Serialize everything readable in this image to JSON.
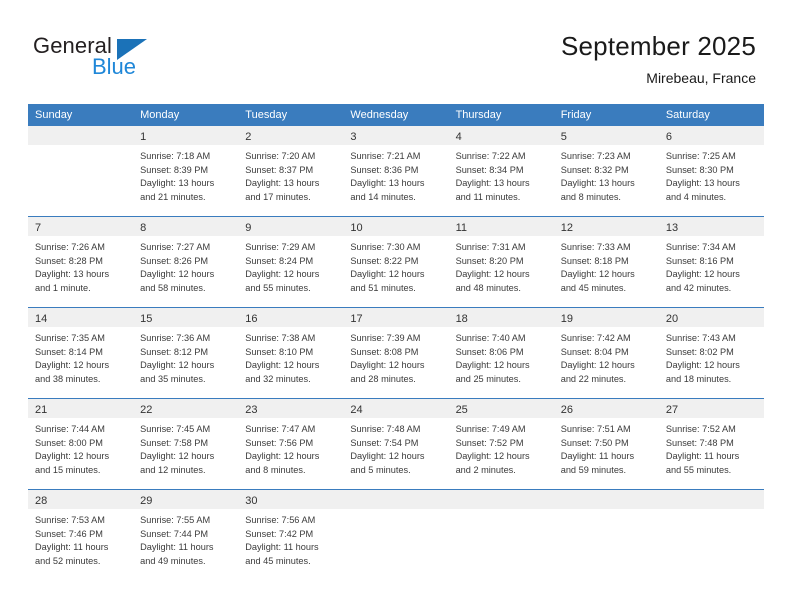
{
  "brand": {
    "name_primary": "General",
    "name_secondary": "Blue",
    "logo_icon": "triangle-logo-icon"
  },
  "header": {
    "title": "September 2025",
    "subtitle": "Mirebeau, France"
  },
  "colors": {
    "header_blue": "#3a7cbe",
    "brand_blue": "#1f87d8",
    "logo_blue": "#1b72b8",
    "daynum_band": "#f0f0f0",
    "text": "#3b3b3b"
  },
  "weekdays": [
    "Sunday",
    "Monday",
    "Tuesday",
    "Wednesday",
    "Thursday",
    "Friday",
    "Saturday"
  ],
  "weeks": [
    [
      {
        "day": "",
        "sunrise": "",
        "sunset": "",
        "daylight_line1": "",
        "daylight_line2": ""
      },
      {
        "day": "1",
        "sunrise": "Sunrise: 7:18 AM",
        "sunset": "Sunset: 8:39 PM",
        "daylight_line1": "Daylight: 13 hours",
        "daylight_line2": "and 21 minutes."
      },
      {
        "day": "2",
        "sunrise": "Sunrise: 7:20 AM",
        "sunset": "Sunset: 8:37 PM",
        "daylight_line1": "Daylight: 13 hours",
        "daylight_line2": "and 17 minutes."
      },
      {
        "day": "3",
        "sunrise": "Sunrise: 7:21 AM",
        "sunset": "Sunset: 8:36 PM",
        "daylight_line1": "Daylight: 13 hours",
        "daylight_line2": "and 14 minutes."
      },
      {
        "day": "4",
        "sunrise": "Sunrise: 7:22 AM",
        "sunset": "Sunset: 8:34 PM",
        "daylight_line1": "Daylight: 13 hours",
        "daylight_line2": "and 11 minutes."
      },
      {
        "day": "5",
        "sunrise": "Sunrise: 7:23 AM",
        "sunset": "Sunset: 8:32 PM",
        "daylight_line1": "Daylight: 13 hours",
        "daylight_line2": "and 8 minutes."
      },
      {
        "day": "6",
        "sunrise": "Sunrise: 7:25 AM",
        "sunset": "Sunset: 8:30 PM",
        "daylight_line1": "Daylight: 13 hours",
        "daylight_line2": "and 4 minutes."
      }
    ],
    [
      {
        "day": "7",
        "sunrise": "Sunrise: 7:26 AM",
        "sunset": "Sunset: 8:28 PM",
        "daylight_line1": "Daylight: 13 hours",
        "daylight_line2": "and 1 minute."
      },
      {
        "day": "8",
        "sunrise": "Sunrise: 7:27 AM",
        "sunset": "Sunset: 8:26 PM",
        "daylight_line1": "Daylight: 12 hours",
        "daylight_line2": "and 58 minutes."
      },
      {
        "day": "9",
        "sunrise": "Sunrise: 7:29 AM",
        "sunset": "Sunset: 8:24 PM",
        "daylight_line1": "Daylight: 12 hours",
        "daylight_line2": "and 55 minutes."
      },
      {
        "day": "10",
        "sunrise": "Sunrise: 7:30 AM",
        "sunset": "Sunset: 8:22 PM",
        "daylight_line1": "Daylight: 12 hours",
        "daylight_line2": "and 51 minutes."
      },
      {
        "day": "11",
        "sunrise": "Sunrise: 7:31 AM",
        "sunset": "Sunset: 8:20 PM",
        "daylight_line1": "Daylight: 12 hours",
        "daylight_line2": "and 48 minutes."
      },
      {
        "day": "12",
        "sunrise": "Sunrise: 7:33 AM",
        "sunset": "Sunset: 8:18 PM",
        "daylight_line1": "Daylight: 12 hours",
        "daylight_line2": "and 45 minutes."
      },
      {
        "day": "13",
        "sunrise": "Sunrise: 7:34 AM",
        "sunset": "Sunset: 8:16 PM",
        "daylight_line1": "Daylight: 12 hours",
        "daylight_line2": "and 42 minutes."
      }
    ],
    [
      {
        "day": "14",
        "sunrise": "Sunrise: 7:35 AM",
        "sunset": "Sunset: 8:14 PM",
        "daylight_line1": "Daylight: 12 hours",
        "daylight_line2": "and 38 minutes."
      },
      {
        "day": "15",
        "sunrise": "Sunrise: 7:36 AM",
        "sunset": "Sunset: 8:12 PM",
        "daylight_line1": "Daylight: 12 hours",
        "daylight_line2": "and 35 minutes."
      },
      {
        "day": "16",
        "sunrise": "Sunrise: 7:38 AM",
        "sunset": "Sunset: 8:10 PM",
        "daylight_line1": "Daylight: 12 hours",
        "daylight_line2": "and 32 minutes."
      },
      {
        "day": "17",
        "sunrise": "Sunrise: 7:39 AM",
        "sunset": "Sunset: 8:08 PM",
        "daylight_line1": "Daylight: 12 hours",
        "daylight_line2": "and 28 minutes."
      },
      {
        "day": "18",
        "sunrise": "Sunrise: 7:40 AM",
        "sunset": "Sunset: 8:06 PM",
        "daylight_line1": "Daylight: 12 hours",
        "daylight_line2": "and 25 minutes."
      },
      {
        "day": "19",
        "sunrise": "Sunrise: 7:42 AM",
        "sunset": "Sunset: 8:04 PM",
        "daylight_line1": "Daylight: 12 hours",
        "daylight_line2": "and 22 minutes."
      },
      {
        "day": "20",
        "sunrise": "Sunrise: 7:43 AM",
        "sunset": "Sunset: 8:02 PM",
        "daylight_line1": "Daylight: 12 hours",
        "daylight_line2": "and 18 minutes."
      }
    ],
    [
      {
        "day": "21",
        "sunrise": "Sunrise: 7:44 AM",
        "sunset": "Sunset: 8:00 PM",
        "daylight_line1": "Daylight: 12 hours",
        "daylight_line2": "and 15 minutes."
      },
      {
        "day": "22",
        "sunrise": "Sunrise: 7:45 AM",
        "sunset": "Sunset: 7:58 PM",
        "daylight_line1": "Daylight: 12 hours",
        "daylight_line2": "and 12 minutes."
      },
      {
        "day": "23",
        "sunrise": "Sunrise: 7:47 AM",
        "sunset": "Sunset: 7:56 PM",
        "daylight_line1": "Daylight: 12 hours",
        "daylight_line2": "and 8 minutes."
      },
      {
        "day": "24",
        "sunrise": "Sunrise: 7:48 AM",
        "sunset": "Sunset: 7:54 PM",
        "daylight_line1": "Daylight: 12 hours",
        "daylight_line2": "and 5 minutes."
      },
      {
        "day": "25",
        "sunrise": "Sunrise: 7:49 AM",
        "sunset": "Sunset: 7:52 PM",
        "daylight_line1": "Daylight: 12 hours",
        "daylight_line2": "and 2 minutes."
      },
      {
        "day": "26",
        "sunrise": "Sunrise: 7:51 AM",
        "sunset": "Sunset: 7:50 PM",
        "daylight_line1": "Daylight: 11 hours",
        "daylight_line2": "and 59 minutes."
      },
      {
        "day": "27",
        "sunrise": "Sunrise: 7:52 AM",
        "sunset": "Sunset: 7:48 PM",
        "daylight_line1": "Daylight: 11 hours",
        "daylight_line2": "and 55 minutes."
      }
    ],
    [
      {
        "day": "28",
        "sunrise": "Sunrise: 7:53 AM",
        "sunset": "Sunset: 7:46 PM",
        "daylight_line1": "Daylight: 11 hours",
        "daylight_line2": "and 52 minutes."
      },
      {
        "day": "29",
        "sunrise": "Sunrise: 7:55 AM",
        "sunset": "Sunset: 7:44 PM",
        "daylight_line1": "Daylight: 11 hours",
        "daylight_line2": "and 49 minutes."
      },
      {
        "day": "30",
        "sunrise": "Sunrise: 7:56 AM",
        "sunset": "Sunset: 7:42 PM",
        "daylight_line1": "Daylight: 11 hours",
        "daylight_line2": "and 45 minutes."
      },
      {
        "day": "",
        "sunrise": "",
        "sunset": "",
        "daylight_line1": "",
        "daylight_line2": ""
      },
      {
        "day": "",
        "sunrise": "",
        "sunset": "",
        "daylight_line1": "",
        "daylight_line2": ""
      },
      {
        "day": "",
        "sunrise": "",
        "sunset": "",
        "daylight_line1": "",
        "daylight_line2": ""
      },
      {
        "day": "",
        "sunrise": "",
        "sunset": "",
        "daylight_line1": "",
        "daylight_line2": ""
      }
    ]
  ]
}
